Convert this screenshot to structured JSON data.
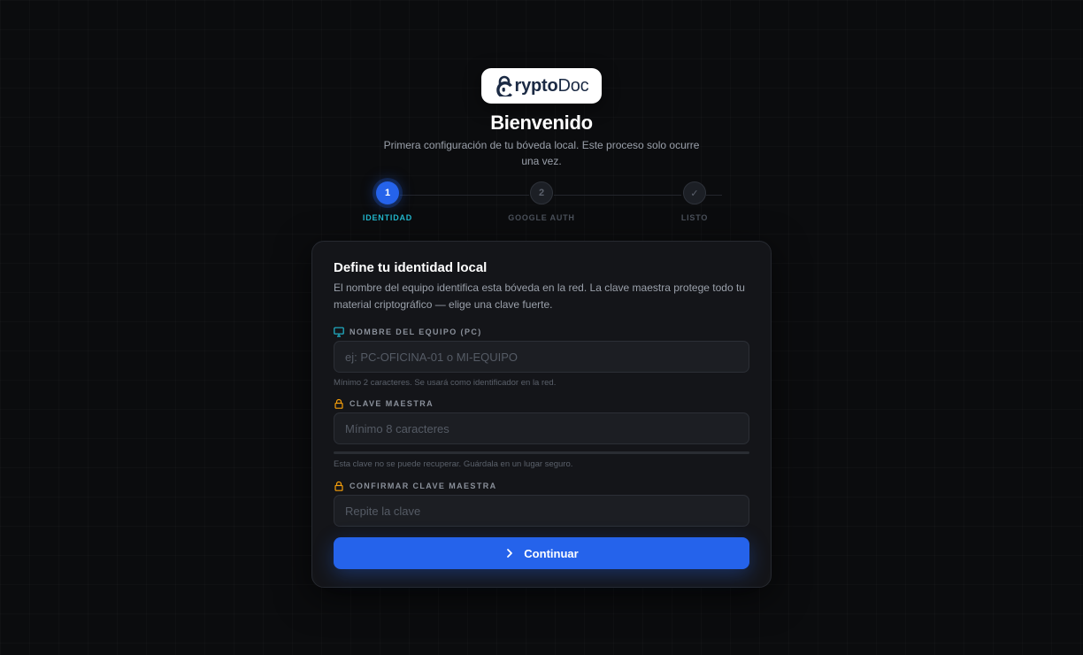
{
  "brand": {
    "logo_bold": "rypto",
    "logo_light": "Doc"
  },
  "header": {
    "title": "Bienvenido",
    "subtitle": "Primera configuración de tu bóveda local. Este proceso solo ocurre una vez."
  },
  "stepper": {
    "steps": [
      {
        "number": "1",
        "label": "IDENTIDAD",
        "state": "active"
      },
      {
        "number": "2",
        "label": "GOOGLE AUTH",
        "state": "pending"
      },
      {
        "number": "✓",
        "label": "LISTO",
        "state": "pending"
      }
    ]
  },
  "form": {
    "title": "Define tu identidad local",
    "description": "El nombre del equipo identifica esta bóveda en la red. La clave maestra protege todo tu material criptográfico — elige una clave fuerte.",
    "device_name": {
      "label": "NOMBRE DEL EQUIPO (PC)",
      "icon": "monitor-icon",
      "placeholder": "ej: PC-OFICINA-01 o MI-EQUIPO",
      "value": "",
      "hint": "Mínimo 2 caracteres. Se usará como identificador en la red."
    },
    "master_key": {
      "label": "CLAVE MAESTRA",
      "icon": "lock-icon",
      "placeholder": "Mínimo 8 caracteres",
      "value": "",
      "strength": 0,
      "hint": "Esta clave no se puede recuperar. Guárdala en un lugar seguro."
    },
    "confirm_key": {
      "label": "CONFIRMAR CLAVE MAESTRA",
      "icon": "lock-icon",
      "placeholder": "Repite la clave",
      "value": ""
    },
    "submit_label": "Continuar"
  },
  "colors": {
    "accent": "#2563eb",
    "active_step_label": "#22b8cf",
    "lock_icon": "#f59e0b",
    "monitor_icon": "#22b8cf"
  }
}
